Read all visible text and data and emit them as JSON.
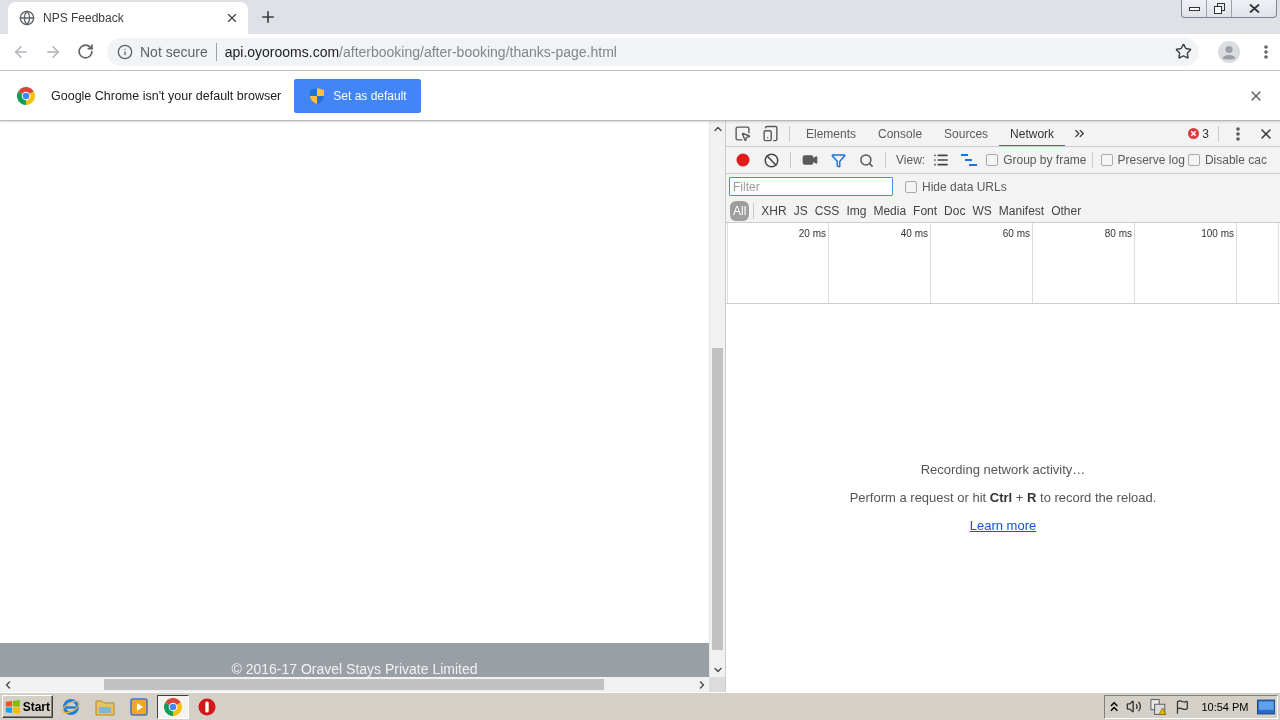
{
  "browser": {
    "tabs": [
      {
        "title": "NPS Feedback",
        "selected": true
      }
    ],
    "address_bar": {
      "security": "Not secure",
      "host": "api.oyorooms.com",
      "path": "/afterbooking/after-booking/thanks-page.html"
    },
    "infobar": {
      "message": "Google Chrome isn't your default browser",
      "button": "Set as default"
    }
  },
  "page": {
    "footer": "© 2016-17 Oravel Stays Private Limited"
  },
  "devtools": {
    "tabs": [
      {
        "label": "Elements",
        "selected": false
      },
      {
        "label": "Console",
        "selected": false
      },
      {
        "label": "Sources",
        "selected": false
      },
      {
        "label": "Network",
        "selected": true
      }
    ],
    "error_count": "3",
    "toolbar": {
      "recording": true,
      "filter_on": true,
      "view_label": "View:",
      "large_rows": false,
      "overview": true,
      "options": [
        {
          "label": "Group by frame",
          "checked": false
        },
        {
          "label": "Preserve log",
          "checked": false
        },
        {
          "label": "Disable cac",
          "checked": false
        }
      ]
    },
    "filter": {
      "placeholder": "Filter",
      "hide_data_urls": {
        "label": "Hide data URLs",
        "checked": false
      }
    },
    "types": [
      {
        "label": "All",
        "selected": true
      },
      {
        "label": "XHR",
        "selected": false
      },
      {
        "label": "JS",
        "selected": false
      },
      {
        "label": "CSS",
        "selected": false
      },
      {
        "label": "Img",
        "selected": false
      },
      {
        "label": "Media",
        "selected": false
      },
      {
        "label": "Font",
        "selected": false
      },
      {
        "label": "Doc",
        "selected": false
      },
      {
        "label": "WS",
        "selected": false
      },
      {
        "label": "Manifest",
        "selected": false
      },
      {
        "label": "Other",
        "selected": false
      }
    ],
    "timeline": {
      "ticks": [
        "20 ms",
        "40 ms",
        "60 ms",
        "80 ms",
        "100 ms"
      ]
    },
    "empty_state": {
      "title": "Recording network activity…",
      "hint": "Perform a request or hit **Ctrl** + **R** to record the reload.",
      "link": "Learn more"
    }
  },
  "taskbar": {
    "start": "Start",
    "apps": [
      {
        "selected": false
      },
      {
        "selected": false
      },
      {
        "selected": false
      },
      {
        "selected": true
      },
      {
        "selected": false
      }
    ],
    "clock": "10:54 PM"
  }
}
